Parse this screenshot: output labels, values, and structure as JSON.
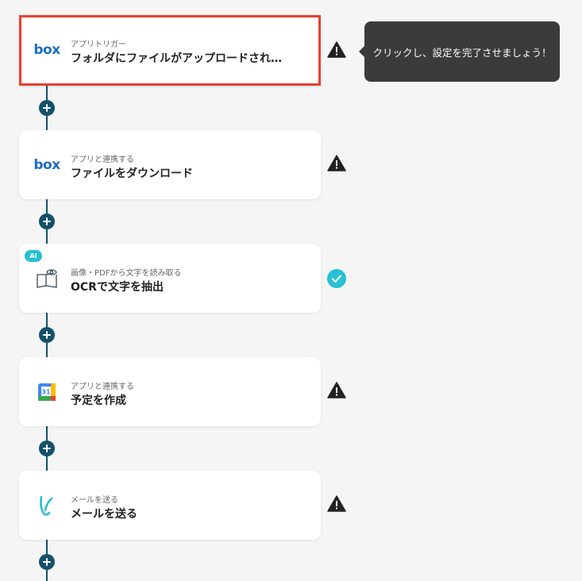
{
  "flow": {
    "steps": [
      {
        "subtitle": "アプリトリガー",
        "title": "フォルダにファイルがアップロードされ…",
        "icon": "box-logo-icon",
        "logo_text": "box",
        "status": "warning-icon"
      },
      {
        "subtitle": "アプリと連携する",
        "title": "ファイルをダウンロード",
        "icon": "box-logo-icon",
        "logo_text": "box",
        "status": "warning-icon"
      },
      {
        "subtitle": "画像・PDFから文字を読み取る",
        "title": "OCRで文字を抽出",
        "icon": "ocr-book-eye-icon",
        "badge": "AI",
        "status": "check-icon"
      },
      {
        "subtitle": "アプリと連携する",
        "title": "予定を作成",
        "icon": "google-calendar-icon",
        "calendar_day": "31",
        "status": "warning-icon"
      },
      {
        "subtitle": "メールを送る",
        "title": "メールを送る",
        "icon": "mail-send-icon",
        "status": "warning-icon"
      }
    ]
  },
  "tooltip": {
    "text": "クリックし、設定を完了させましょう！"
  },
  "colors": {
    "connector": "#14506a",
    "selected_border": "#e8402c",
    "check": "#28c0d3",
    "warning": "#222222",
    "tooltip_bg": "#3b3b3b"
  }
}
